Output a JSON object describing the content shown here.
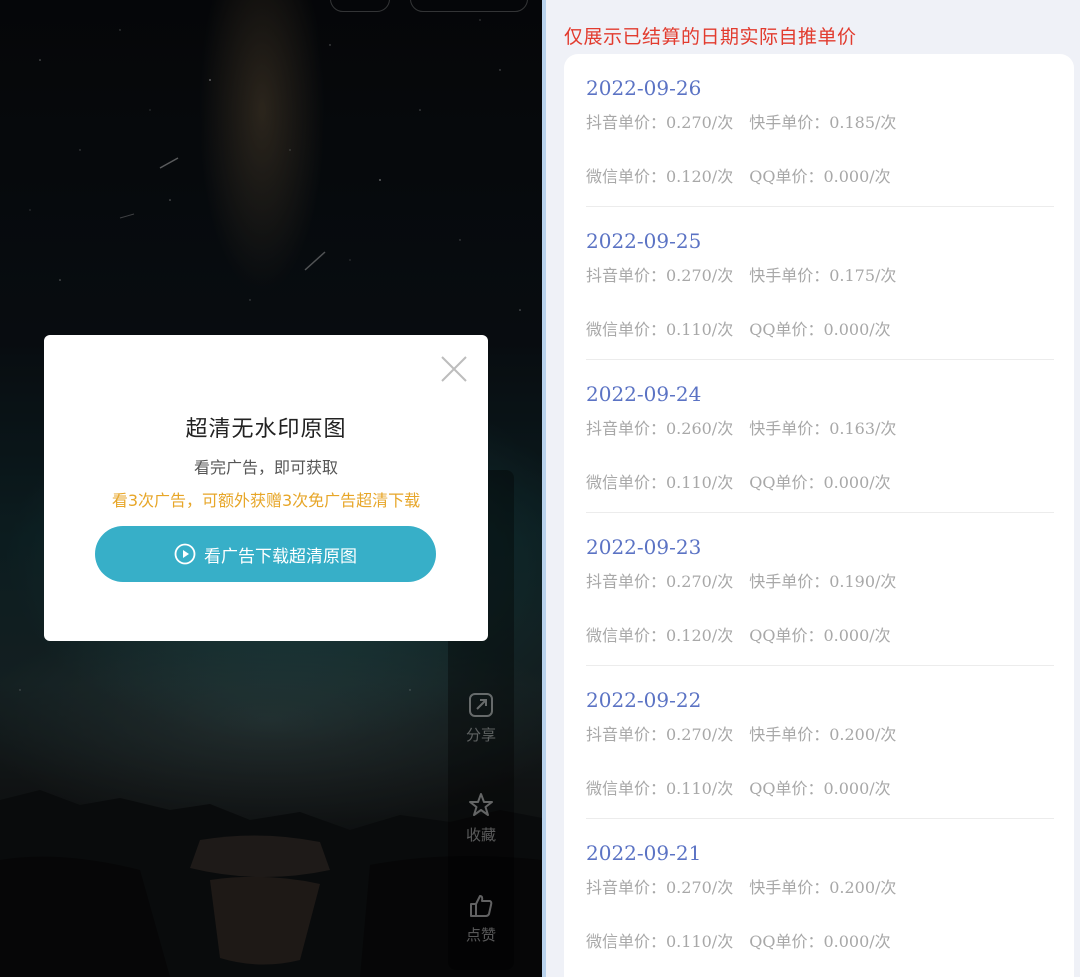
{
  "wallpaper_app": {
    "side_actions": [
      {
        "label": "分享",
        "icon": "share-icon"
      },
      {
        "label": "收藏",
        "icon": "star-icon"
      },
      {
        "label": "点赞",
        "icon": "thumbs-up-icon"
      }
    ],
    "modal": {
      "title": "超清无水印原图",
      "subtitle": "看完广告，即可获取",
      "promo": "看3次广告，可额外获赠3次免广告超清下载",
      "button_label": "看广告下载超清原图",
      "button_icon": "play-circle-icon",
      "close_icon": "close-icon",
      "button_color": "#37afc8",
      "promo_color": "#e7a628"
    }
  },
  "price_panel": {
    "notice": "仅展示已结算的日期实际自推单价",
    "notice_color": "#e23b2e",
    "date_color": "#5b73c4",
    "entries": [
      {
        "date": "2022-09-26",
        "douyin": "抖音单价：0.270/次",
        "kuaishou": "快手单价：0.185/次",
        "wechat": "微信单价：0.120/次",
        "qq": "QQ单价：0.000/次"
      },
      {
        "date": "2022-09-25",
        "douyin": "抖音单价：0.270/次",
        "kuaishou": "快手单价：0.175/次",
        "wechat": "微信单价：0.110/次",
        "qq": "QQ单价：0.000/次"
      },
      {
        "date": "2022-09-24",
        "douyin": "抖音单价：0.260/次",
        "kuaishou": "快手单价：0.163/次",
        "wechat": "微信单价：0.110/次",
        "qq": "QQ单价：0.000/次"
      },
      {
        "date": "2022-09-23",
        "douyin": "抖音单价：0.270/次",
        "kuaishou": "快手单价：0.190/次",
        "wechat": "微信单价：0.120/次",
        "qq": "QQ单价：0.000/次"
      },
      {
        "date": "2022-09-22",
        "douyin": "抖音单价：0.270/次",
        "kuaishou": "快手单价：0.200/次",
        "wechat": "微信单价：0.110/次",
        "qq": "QQ单价：0.000/次"
      },
      {
        "date": "2022-09-21",
        "douyin": "抖音单价：0.270/次",
        "kuaishou": "快手单价：0.200/次",
        "wechat": "微信单价：0.110/次",
        "qq": "QQ单价：0.000/次"
      }
    ]
  }
}
